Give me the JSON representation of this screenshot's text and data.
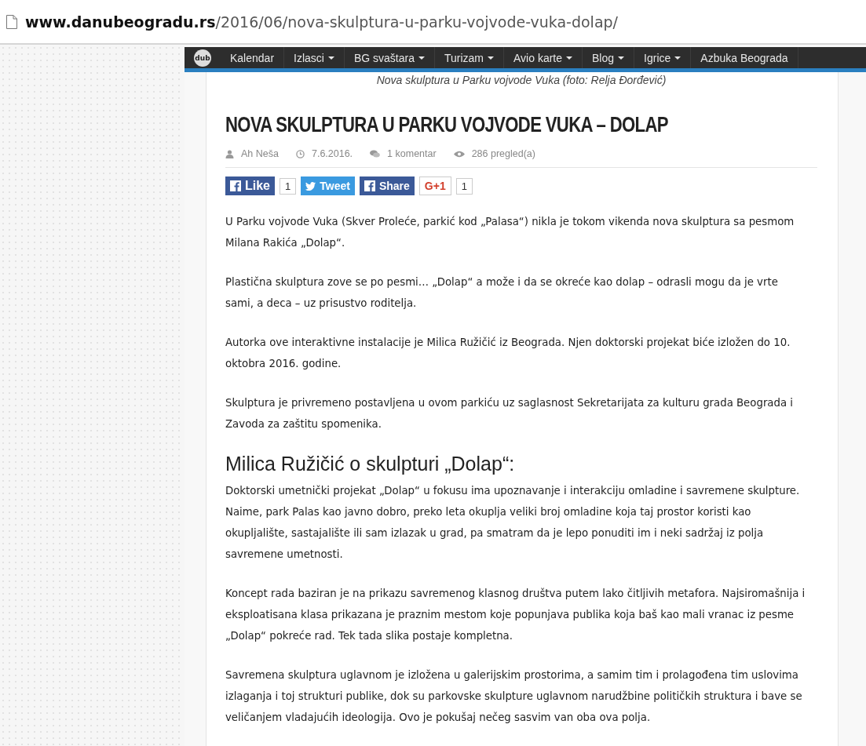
{
  "address_bar": {
    "domain": "www.danubeogradu.rs",
    "path": "/2016/06/nova-skulptura-u-parku-vojvode-vuka-dolap/"
  },
  "nav": {
    "logo": "dub",
    "items": [
      {
        "label": "Kalendar",
        "dropdown": false
      },
      {
        "label": "Izlasci",
        "dropdown": true
      },
      {
        "label": "BG svaštara",
        "dropdown": true
      },
      {
        "label": "Turizam",
        "dropdown": true
      },
      {
        "label": "Avio karte",
        "dropdown": true
      },
      {
        "label": "Blog",
        "dropdown": true
      },
      {
        "label": "Igrice",
        "dropdown": true
      },
      {
        "label": "Azbuka Beograda",
        "dropdown": false
      }
    ]
  },
  "article": {
    "caption": "Nova skulptura u Parku vojvode Vuka (foto: Relja Đorđević)",
    "title": "NOVA SKULPTURA U PARKU VOJVODE VUKA – DOLAP",
    "meta": [
      {
        "kind": "author",
        "text": "Ah Neša"
      },
      {
        "kind": "date",
        "text": "7.6.2016."
      },
      {
        "kind": "comments",
        "text": "1 komentar"
      },
      {
        "kind": "views",
        "text": "286 pregled(a)"
      }
    ],
    "share": [
      {
        "kind": "like",
        "label": "Like",
        "count": "1"
      },
      {
        "kind": "tweet",
        "label": "Tweet"
      },
      {
        "kind": "share",
        "label": "Share"
      },
      {
        "kind": "gplus",
        "label": "G+1",
        "count": "1"
      }
    ],
    "blocks": [
      {
        "kind": "p",
        "text": "U Parku vojvode Vuka (Skver Proleće, parkić kod „Palasa“) nikla je tokom vikenda nova skulptura sa pesmom Milana Rakića „Dolap“."
      },
      {
        "kind": "p",
        "text": "Plastična skulptura zove se po pesmi… „Dolap“ a može i da se okreće kao dolap – odrasli mogu da je vrte sami, a deca – uz prisustvo roditelja."
      },
      {
        "kind": "p",
        "text": "Autorka ove interaktivne instalacije je Milica Ružičić iz Beograda. Njen doktorski projekat biće izložen do 10. oktobra 2016. godine."
      },
      {
        "kind": "p",
        "text": "Skulptura je privremeno postavljena u ovom parkiću uz saglasnost Sekretarijata za kulturu grada Beograda i Zavoda za zaštitu spomenika."
      },
      {
        "kind": "h2",
        "text": "Milica Ružičić o skulpturi „Dolap“:"
      },
      {
        "kind": "p",
        "text": "Doktorski umetnički projekat „Dolap“ u fokusu ima upoznavanje i interakciju omladine i savremene skulpture. Naime, park Palas kao javno dobro, preko leta okuplja veliki broj omladine koja taj prostor koristi kao okupljalište, sastajalište ili sam izlazak u grad, pa smatram da je lepo ponuditi im i neki sadržaj iz polja savremene umetnosti."
      },
      {
        "kind": "p",
        "text": "Koncept rada baziran je na prikazu savremenog klasnog društva putem lako čitljivih metafora. Najsiromašnija i eksploatisana klasa prikazana je praznim mestom koje popunjava publika koja baš kao mali vranac iz pesme „Dolap“ pokreće rad. Tek tada slika postaje kompletna."
      },
      {
        "kind": "p",
        "text": "Savremena skulptura uglavnom je izložena u galerijskim prostorima, a samim tim i prolagođena tim uslovima izlaganja i toj strukturi publike, dok su parkovske skulpture uglavnom narudžbine političkih struktura i bave se veličanjem vladajućih ideologija. Ovo je pokušaj nečeg sasvim van oba ova polja."
      }
    ]
  }
}
